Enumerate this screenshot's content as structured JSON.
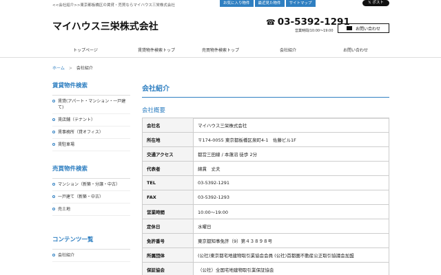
{
  "topbar": {
    "tagline": "<<会社紹介>>東京都板橋区の賃貸・売買ならマイハウス三栄株式会社",
    "buttons": [
      "お気に入り物件",
      "最近見た物件",
      "サイトマップ"
    ],
    "post_label": "ポスト"
  },
  "header": {
    "company_name": "マイハウス三栄株式会社",
    "phone": "03-5392-1291",
    "hours": "営業時間/10:00〜19:00",
    "contact_label": "お問い合わせ"
  },
  "nav": {
    "items": [
      "トップページ",
      "賃貸物件検索トップ",
      "売買物件検索トップ",
      "会社紹介",
      "お問い合わせ"
    ]
  },
  "breadcrumb": {
    "home": "ホーム",
    "separator": ">",
    "current": "会社紹介"
  },
  "sidebar": {
    "rent": {
      "title": "賃貸物件検索",
      "items": [
        "賃貸(アパート・マンション・一戸建て)",
        "賃店舗（テナント）",
        "賃事務所（貸オフィス）",
        "賃駐車場"
      ]
    },
    "sale": {
      "title": "売買物件検索",
      "items": [
        "マンション（新築・分譲・中古）",
        "一戸建て（新築・中古）",
        "売土地"
      ]
    },
    "contents": {
      "title": "コンテンツ一覧",
      "items": [
        "会社紹介"
      ]
    }
  },
  "main": {
    "page_title": "会社紹介",
    "section_title": "会社概要",
    "rows": [
      {
        "label": "会社名",
        "value": "マイハウス三栄株式会社"
      },
      {
        "label": "所在地",
        "value": "〒174-0055 東京都板橋区泉町4-1　佐藤ビル1F"
      },
      {
        "label": "交通アクセス",
        "value": "都営三田線 / 本蓮沼 徒歩 2分"
      },
      {
        "label": "代表者",
        "value": "綿貫　丈夫"
      },
      {
        "label": "TEL",
        "value": "03-5392-1291"
      },
      {
        "label": "FAX",
        "value": "03-5392-1293"
      },
      {
        "label": "営業時間",
        "value": "10:00〜19:00"
      },
      {
        "label": "定休日",
        "value": "水曜日"
      },
      {
        "label": "免許番号",
        "value": "東京都知事免許（9）第４３８９８号"
      },
      {
        "label": "所属団体",
        "value": "(公社)東京都宅地建物取引業協会会員 (公社)首都圏不動産公正取引協議会加盟"
      },
      {
        "label": "保証協会",
        "value": "（公社）全国宅地建物取引業保証協会"
      }
    ]
  },
  "colors": {
    "accent": "#2f7fc1",
    "border": "#cccccc",
    "header_cell": "#f4f4f4"
  }
}
